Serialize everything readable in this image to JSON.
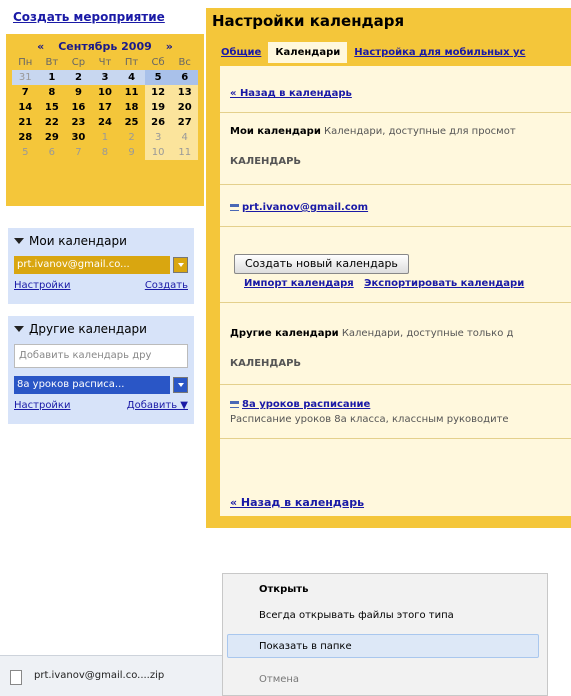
{
  "left": {
    "create_event": "Создать мероприятие",
    "mini_calendar": {
      "prev": "«",
      "month": "Сентябрь 2009",
      "next": "»",
      "weekdays": [
        "Пн",
        "Вт",
        "Ср",
        "Чт",
        "Пт",
        "Сб",
        "Вс"
      ],
      "weeks": [
        [
          "31",
          "1",
          "2",
          "3",
          "4",
          "5",
          "6"
        ],
        [
          "7",
          "8",
          "9",
          "10",
          "11",
          "12",
          "13"
        ],
        [
          "14",
          "15",
          "16",
          "17",
          "18",
          "19",
          "20"
        ],
        [
          "21",
          "22",
          "23",
          "24",
          "25",
          "26",
          "27"
        ],
        [
          "28",
          "29",
          "30",
          "1",
          "2",
          "3",
          "4"
        ],
        [
          "5",
          "6",
          "7",
          "8",
          "9",
          "10",
          "11"
        ]
      ]
    },
    "my_calendars": {
      "title": "Мои календари",
      "calendar": "prt.ivanov@gmail.co...",
      "settings": "Настройки",
      "create": "Создать"
    },
    "other_calendars": {
      "title": "Другие календари",
      "placeholder": "Добавить календарь дру",
      "calendar": "8а уроков расписа...",
      "settings": "Настройки",
      "add": "Добавить ▼"
    }
  },
  "main": {
    "title": "Настройки календаря",
    "tabs": [
      "Общие",
      "Календари",
      "Настройка для мобильных ус"
    ],
    "back_top": "« Назад в календарь",
    "my_cals_label": "Мои календари",
    "my_cals_desc": "Календари, доступные для просмот",
    "section_calendar": "КАЛЕНДАРЬ",
    "my_calendar_link": "prt.ivanov@gmail.com",
    "create_button": "Создать новый календарь",
    "import_link": "Импорт календаря",
    "export_link": "Экспортировать календари",
    "other_cals_label": "Другие календари",
    "other_cals_desc": "Календари, доступные только д",
    "section_calendar2": "КАЛЕНДАРЬ",
    "other_calendar_link": "8а уроков расписание",
    "other_calendar_desc": "Расписание уроков 8а класса, классным руководите",
    "back_bottom": "« Назад в календарь"
  },
  "context_menu": {
    "items": [
      "Открыть",
      "Всегда открывать файлы этого типа",
      "Показать в папке",
      "Отмена"
    ]
  },
  "download_bar": {
    "file": "prt.ivanov@gmail.co....zip"
  },
  "colors": {
    "accent_yellow": "#f4c63a",
    "panel_blue": "#d7e3f9",
    "my_cal_color": "#d9a610",
    "other_cal_color": "#2a56c6",
    "link": "#1a1aa6"
  }
}
